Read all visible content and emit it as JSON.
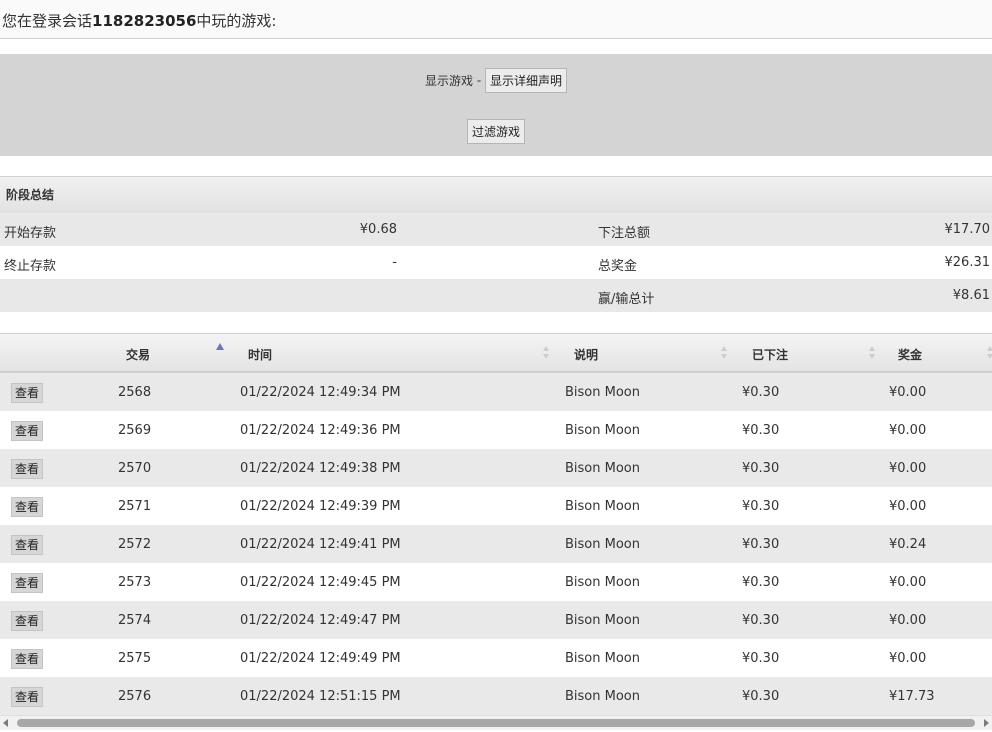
{
  "header": {
    "prefix": "您在登录会话",
    "session_id": "1182823056",
    "suffix": "中玩的游戏:"
  },
  "filter": {
    "show_games_label": "显示游戏",
    "separator": "-",
    "show_details_button": "显示详细声明",
    "filter_button": "过滤游戏"
  },
  "summary": {
    "title": "阶段总结",
    "start_balance_label": "开始存款",
    "start_balance_value": "¥0.68",
    "end_balance_label": "终止存款",
    "end_balance_value": "-",
    "total_bet_label": "下注总额",
    "total_bet_value": "¥17.70",
    "total_win_label": "总奖金",
    "total_win_value": "¥26.31",
    "net_label": "赢/输总计",
    "net_value": "¥8.61"
  },
  "table": {
    "columns": [
      "交易",
      "时间",
      "说明",
      "已下注",
      "奖金"
    ],
    "view_label": "查看",
    "rows": [
      {
        "id": "2568",
        "time": "01/22/2024 12:49:34 PM",
        "desc": "Bison Moon",
        "bet": "¥0.30",
        "win": "¥0.00"
      },
      {
        "id": "2569",
        "time": "01/22/2024 12:49:36 PM",
        "desc": "Bison Moon",
        "bet": "¥0.30",
        "win": "¥0.00"
      },
      {
        "id": "2570",
        "time": "01/22/2024 12:49:38 PM",
        "desc": "Bison Moon",
        "bet": "¥0.30",
        "win": "¥0.00"
      },
      {
        "id": "2571",
        "time": "01/22/2024 12:49:39 PM",
        "desc": "Bison Moon",
        "bet": "¥0.30",
        "win": "¥0.00"
      },
      {
        "id": "2572",
        "time": "01/22/2024 12:49:41 PM",
        "desc": "Bison Moon",
        "bet": "¥0.30",
        "win": "¥0.24"
      },
      {
        "id": "2573",
        "time": "01/22/2024 12:49:45 PM",
        "desc": "Bison Moon",
        "bet": "¥0.30",
        "win": "¥0.00"
      },
      {
        "id": "2574",
        "time": "01/22/2024 12:49:47 PM",
        "desc": "Bison Moon",
        "bet": "¥0.30",
        "win": "¥0.00"
      },
      {
        "id": "2575",
        "time": "01/22/2024 12:49:49 PM",
        "desc": "Bison Moon",
        "bet": "¥0.30",
        "win": "¥0.00"
      },
      {
        "id": "2576",
        "time": "01/22/2024 12:51:15 PM",
        "desc": "Bison Moon",
        "bet": "¥0.30",
        "win": "¥17.73"
      }
    ]
  },
  "colors": {
    "panel_bg": "#d4d4d4",
    "row_alt": "#e9e9e9",
    "sort_indicator": "#6b73c9"
  }
}
